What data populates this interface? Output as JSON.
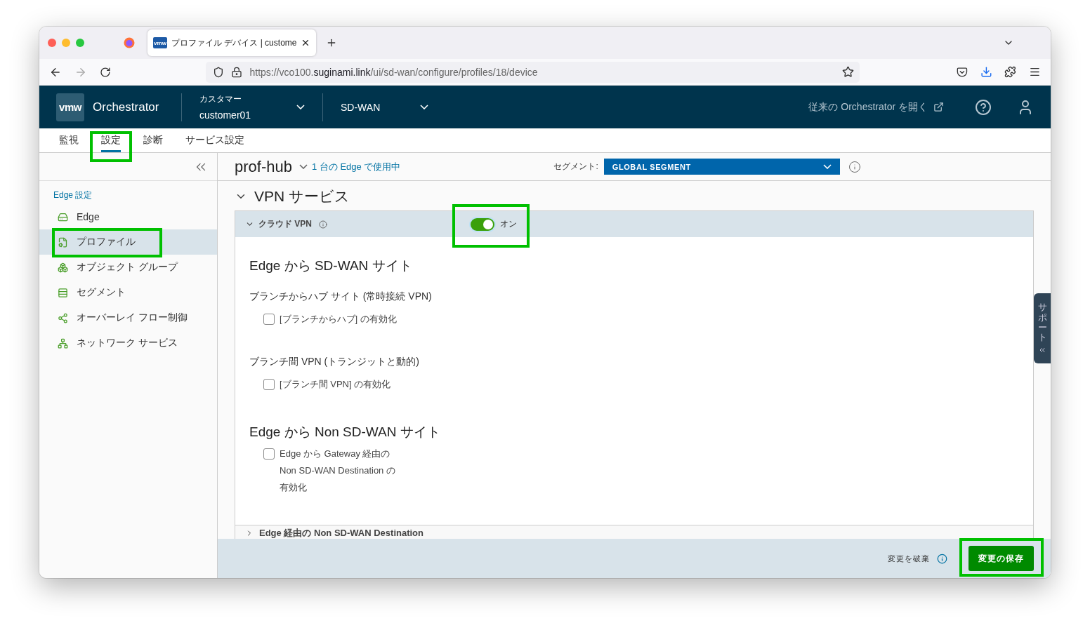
{
  "browser": {
    "tab_title": "プロファイル デバイス | custome",
    "favicon": "vmw",
    "url_scheme": "https://vco100.",
    "url_domain": "suginami.link",
    "url_path": "/ui/sd-wan/configure/profiles/18/device"
  },
  "header": {
    "logo": "vmw",
    "product": "Orchestrator",
    "customer_label": "カスタマー",
    "customer": "customer01",
    "service": "SD-WAN",
    "classic_link": "従来の Orchestrator を開く"
  },
  "nav_tabs": [
    {
      "label": "監視",
      "selected": false,
      "highlighted": false
    },
    {
      "label": "設定",
      "selected": true,
      "highlighted": true
    },
    {
      "label": "診断",
      "selected": false,
      "highlighted": false
    },
    {
      "label": "サービス設定",
      "selected": false,
      "highlighted": false
    }
  ],
  "sidebar": {
    "section": "Edge 設定",
    "items": [
      {
        "label": "Edge",
        "selected": false,
        "highlighted": false
      },
      {
        "label": "プロファイル",
        "selected": true,
        "highlighted": true
      },
      {
        "label": "オブジェクト グループ",
        "selected": false,
        "highlighted": false
      },
      {
        "label": "セグメント",
        "selected": false,
        "highlighted": false
      },
      {
        "label": "オーバーレイ フロー制御",
        "selected": false,
        "highlighted": false
      },
      {
        "label": "ネットワーク サービス",
        "selected": false,
        "highlighted": false
      }
    ]
  },
  "profile": {
    "name": "prof-hub",
    "usage": "1 台の Edge で使用中",
    "segment_label": "セグメント:",
    "segment": "GLOBAL SEGMENT"
  },
  "section": {
    "title": "VPN サービス",
    "expanded": true
  },
  "panel": {
    "title": "クラウド VPN",
    "on": true,
    "toggle_label": "オン",
    "highlighted": true,
    "expanded": true,
    "items": [
      {
        "kind": "heading",
        "text": "Edge から SD-WAN サイト"
      },
      {
        "kind": "subheading",
        "text": "ブランチからハブ サイト (常時接続 VPN)"
      },
      {
        "kind": "checkbox",
        "lines": [
          "[ブランチからハブ] の有効化"
        ],
        "checked": false
      },
      {
        "kind": "subheading",
        "text": "ブランチ間 VPN (トランジットと動的)"
      },
      {
        "kind": "checkbox",
        "lines": [
          "[ブランチ間 VPN] の有効化"
        ],
        "checked": false
      },
      {
        "kind": "heading",
        "text": "Edge から Non SD-WAN サイト"
      },
      {
        "kind": "checkbox",
        "lines": [
          "Edge から Gateway 経由の",
          "Non SD-WAN Destination の",
          "有効化"
        ],
        "checked": false
      }
    ]
  },
  "next_panel": {
    "title": "Edge 経由の Non SD-WAN Destination",
    "expanded": false
  },
  "footer": {
    "discard": "変更を破棄",
    "save": "変更の保存",
    "save_highlighted": true
  },
  "support_tab": {
    "label": "サポート"
  }
}
